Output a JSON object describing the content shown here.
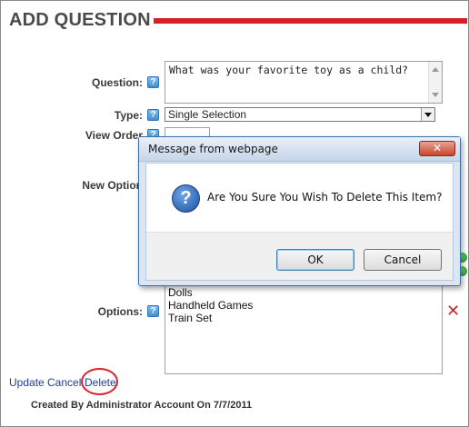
{
  "page": {
    "title": "ADD QUESTION",
    "accent_color": "#d81e26"
  },
  "form": {
    "question_label": "Question:",
    "question_value": "What was your favorite toy as a child?",
    "type_label": "Type:",
    "type_value": "Single Selection",
    "view_order_label": "View Order",
    "view_order_value": "",
    "new_option_label": "New Option",
    "options_label": "Options:",
    "options": [
      "Dolls",
      "Handheld Games",
      "Train Set"
    ],
    "help_icon_glyph": "?"
  },
  "actions": {
    "update": "Update",
    "cancel": "Cancel",
    "delete": "Delete"
  },
  "footer": {
    "created_by": "Created By Administrator Account On 7/7/2011"
  },
  "dialog": {
    "title": "Message from webpage",
    "close_glyph": "✕",
    "icon_glyph": "?",
    "message": "Are You Sure You Wish To Delete This Item?",
    "ok_label": "OK",
    "cancel_label": "Cancel"
  },
  "icons": {
    "help": "help-icon",
    "add": "green-circle-icon",
    "remove": "red-x-icon",
    "question": "question-icon"
  }
}
